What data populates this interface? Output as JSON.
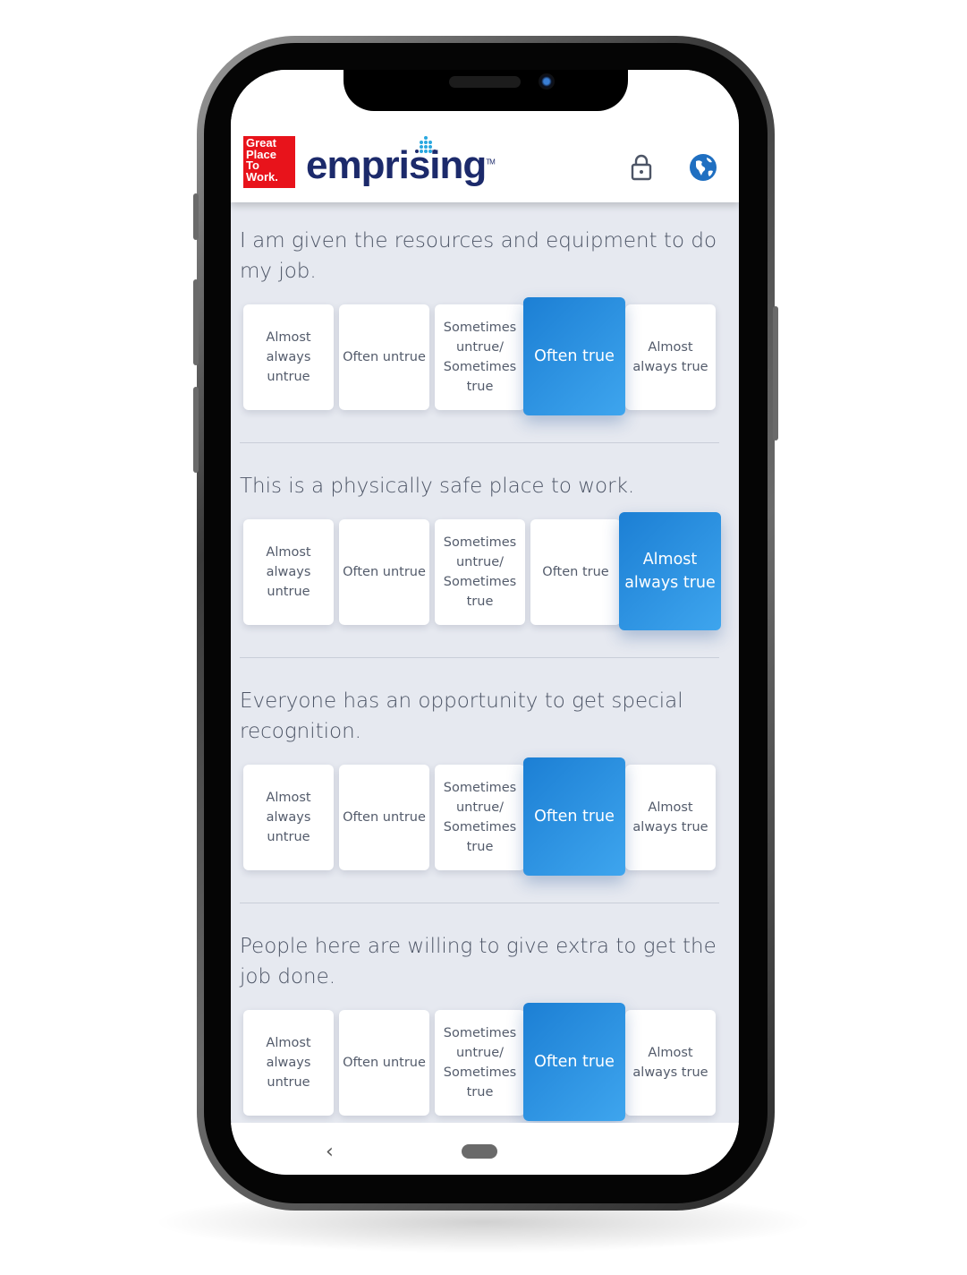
{
  "header": {
    "gptw_logo_text": "Great Place To Work.",
    "brand": "emprising",
    "trademark": "TM",
    "icons": [
      "lock-icon",
      "globe-icon"
    ]
  },
  "scale_options": [
    "Almost always untrue",
    "Often untrue",
    "Sometimes untrue/ Sometimes true",
    "Often true",
    "Almost always true"
  ],
  "questions": [
    {
      "text": "I am given the resources and equipment to do my job.",
      "selected": "Often true"
    },
    {
      "text": "This is a physically safe place to work.",
      "selected": "Almost always true"
    },
    {
      "text": "Everyone has an opportunity to get special recognition.",
      "selected": "Often true"
    },
    {
      "text": "People here are willing to give extra to get the job done.",
      "selected": "Often true"
    }
  ],
  "navbar": {
    "back_icon": "chevron-left-icon",
    "home_icon": "home-pill-icon"
  },
  "colors": {
    "accent": "#2a8fe0",
    "brand_navy": "#1c2a6b",
    "gptw_red": "#e8131b",
    "background": "#e6e9f0"
  }
}
